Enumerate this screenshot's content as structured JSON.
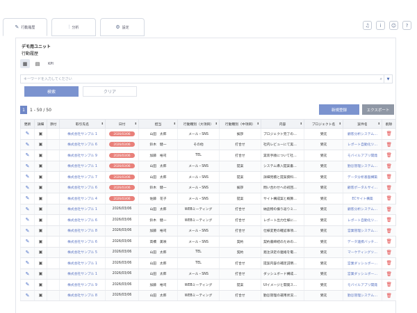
{
  "tabs": [
    {
      "label": "行動履歴",
      "icon": "edit-icon"
    },
    {
      "label": "分析",
      "icon": "chart-icon"
    },
    {
      "label": "設定",
      "icon": "settings-icon"
    }
  ],
  "header": {
    "unit": "デモ用ユニット",
    "title": "行動履歴"
  },
  "view": {
    "kpi_label": "KPI"
  },
  "search": {
    "placeholder": "キーワードを入力してください",
    "search_label": "検索",
    "clear_label": "クリア"
  },
  "pagination": {
    "current": "1",
    "range": "1 - 50 / 50"
  },
  "actions": {
    "new_label": "新規登録",
    "export_label": "エクスポート"
  },
  "columns": [
    "更新",
    "詳細",
    "添付",
    "取引先名",
    "日付",
    "担当",
    "行動種別（大項目）",
    "行動種別（中項目）",
    "内容",
    "プロジェクト名",
    "案件名",
    "削除"
  ],
  "rows": [
    {
      "client": "株式会社サンプル 1",
      "date": "2026/03/06",
      "pill": true,
      "staff": "山田　太郎",
      "major": "メール・SNS",
      "mid": "挨拶",
      "content": "プロジェクト完了の…",
      "project": "受託",
      "deal": "顧客分析システム…"
    },
    {
      "client": "株式会社サンプル 6",
      "date": "2026/03/06",
      "pill": true,
      "staff": "鈴木　健一",
      "major": "その他",
      "mid": "打合せ",
      "content": "社内レビューにて実…",
      "project": "受託",
      "deal": "レポート自動化ツ…"
    },
    {
      "client": "株式会社サンプル 9",
      "date": "2026/03/06",
      "pill": true,
      "staff": "加藤　裕司",
      "major": "TEL",
      "mid": "打合せ",
      "content": "実装手順について社…",
      "project": "受託",
      "deal": "モバイルアプリ開発"
    },
    {
      "client": "株式会社サンプル 1",
      "date": "2026/03/06",
      "pill": true,
      "staff": "山田　太郎",
      "major": "メール・SNS",
      "mid": "提案",
      "content": "システム導入提案書…",
      "project": "受託",
      "deal": "勤怠管理システム…"
    },
    {
      "client": "株式会社サンプル 7",
      "date": "2026/03/06",
      "pill": true,
      "staff": "山田　太郎",
      "major": "メール・SNS",
      "mid": "提案",
      "content": "詳細見積と提案資料…",
      "project": "受託",
      "deal": "データ分析基盤構築"
    },
    {
      "client": "株式会社サンプル 6",
      "date": "2026/03/06",
      "pill": true,
      "staff": "鈴木　健一",
      "major": "メール・SNS",
      "mid": "挨拶",
      "content": "問い合わせへの初回…",
      "project": "受託",
      "deal": "顧客ポータルサイ…"
    },
    {
      "client": "株式会社サンプル 4",
      "date": "2026/03/06",
      "pill": true,
      "staff": "佐藤　花子",
      "major": "メール・SNS",
      "mid": "提案",
      "content": "サイト構成案と概算…",
      "project": "受託",
      "deal": "ECサイト構築"
    },
    {
      "client": "株式会社サンプル 1",
      "date": "2026/03/06",
      "pill": false,
      "staff": "山田　太郎",
      "major": "WEBミーティング",
      "mid": "打合せ",
      "content": "納品物の振り返りミ…",
      "project": "受託",
      "deal": "顧客分析システム…"
    },
    {
      "client": "株式会社サンプル 6",
      "date": "2026/03/06",
      "pill": false,
      "staff": "鈴木　健一",
      "major": "WEBミーティング",
      "mid": "打合せ",
      "content": "レポート出力仕様に…",
      "project": "受託",
      "deal": "レポート自動化ツ…"
    },
    {
      "client": "株式会社サンプル 8",
      "date": "2026/03/06",
      "pill": false,
      "staff": "加藤　裕司",
      "major": "メール・SNS",
      "mid": "打合せ",
      "content": "仕様変更の確認事項…",
      "project": "受託",
      "deal": "営業管理システム…"
    },
    {
      "client": "株式会社サンプル 6",
      "date": "2026/03/06",
      "pill": false,
      "staff": "高橋　美咲",
      "major": "メール・SNS",
      "mid": "契約",
      "content": "契約書締結のための…",
      "project": "受託",
      "deal": "データ連携バッチ…"
    },
    {
      "client": "株式会社サンプル 5",
      "date": "2026/03/06",
      "pill": false,
      "staff": "山田　太郎",
      "major": "TEL",
      "mid": "契約",
      "content": "発注決定の連絡を電…",
      "project": "受託",
      "deal": "マーケティングツ…"
    },
    {
      "client": "株式会社サンプル 1",
      "date": "2026/03/06",
      "pill": false,
      "staff": "山田　太郎",
      "major": "TEL",
      "mid": "打合せ",
      "content": "提案内容の補足説明…",
      "project": "受託",
      "deal": "営業ダッシュボー…"
    },
    {
      "client": "株式会社サンプル 1",
      "date": "2026/03/06",
      "pill": false,
      "staff": "山田　太郎",
      "major": "メール・SNS",
      "mid": "打合せ",
      "content": "ダッシュボード構成…",
      "project": "受託",
      "deal": "営業ダッシュボー…"
    },
    {
      "client": "株式会社サンプル 9",
      "date": "2026/03/06",
      "pill": false,
      "staff": "加藤　裕司",
      "major": "WEBミーティング",
      "mid": "提案",
      "content": "UIイメージと開発ス…",
      "project": "受託",
      "deal": "モバイルアプリ開発"
    },
    {
      "client": "株式会社サンプル 8",
      "date": "2026/03/06",
      "pill": false,
      "staff": "山田　太郎",
      "major": "WEBミーティング",
      "mid": "打合せ",
      "content": "勤怠管理の運用状況…",
      "project": "受託",
      "deal": "勤怠管理システム…"
    }
  ]
}
